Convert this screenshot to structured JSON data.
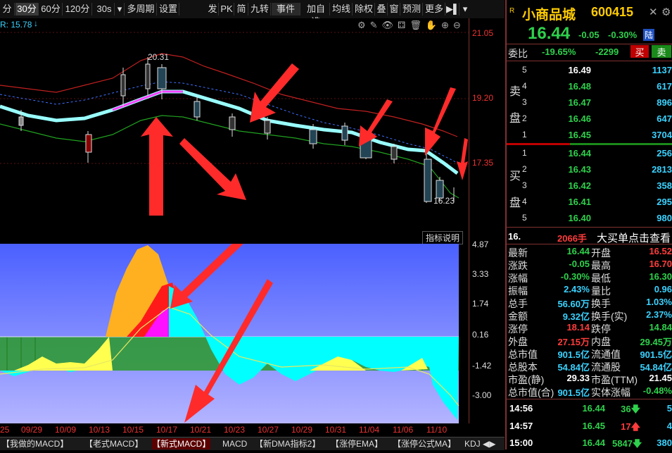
{
  "toolbar": {
    "items": [
      "分",
      "30分",
      "60分",
      "120分",
      "30s",
      "多周期",
      "设置"
    ],
    "right_items": [
      "发",
      "PK",
      "简",
      "九转",
      "事件",
      "加自选",
      "均线",
      "除权",
      "叠",
      "窗",
      "预测",
      "更多"
    ]
  },
  "chart": {
    "ma_label": "R: 15.78",
    "price_axis": [
      "21.05",
      "19.20",
      "17.35"
    ],
    "high_marker": "20.31",
    "low_marker": "16.23",
    "macd_header": "指标说明",
    "macd_axis": [
      "4.87",
      "3.33",
      "1.74",
      "0.16",
      "-1.42",
      "-3.00"
    ],
    "dates": [
      "25",
      "09/29",
      "10/09",
      "10/13",
      "10/15",
      "10/17",
      "10/21",
      "10/23",
      "10/27",
      "10/29",
      "10/31",
      "11/04",
      "11/06",
      "11/10"
    ]
  },
  "bottom_tabs": [
    "我做的MACD",
    "老式MACD",
    "新式MACD",
    "MACD",
    "新DMA指标2",
    "涨停EMA",
    "涨停公式MA",
    "KDJ"
  ],
  "quote": {
    "name": "小商品城",
    "code": "600415",
    "price": "16.44",
    "change": "-0.05",
    "change_pct": "-0.30%",
    "exchange": "陆",
    "weibi_label": "委比",
    "weibi": "-19.65%",
    "weicha": "-2299",
    "sell_btn": "买",
    "buy_btn": "卖",
    "sell_label": [
      "卖",
      "盘"
    ],
    "buy_label": [
      "买",
      "盘"
    ],
    "asks": [
      {
        "lvl": "5",
        "price": "16.49",
        "vol": "1137"
      },
      {
        "lvl": "4",
        "price": "16.48",
        "vol": "617"
      },
      {
        "lvl": "3",
        "price": "16.47",
        "vol": "896"
      },
      {
        "lvl": "2",
        "price": "16.46",
        "vol": "647"
      },
      {
        "lvl": "1",
        "price": "16.45",
        "vol": "3704"
      }
    ],
    "bids": [
      {
        "lvl": "1",
        "price": "16.44",
        "vol": "256"
      },
      {
        "lvl": "2",
        "price": "16.43",
        "vol": "2813"
      },
      {
        "lvl": "3",
        "price": "16.42",
        "vol": "358"
      },
      {
        "lvl": "4",
        "price": "16.41",
        "vol": "295"
      },
      {
        "lvl": "5",
        "price": "16.40",
        "vol": "980"
      }
    ],
    "big_order_price": "16.",
    "big_order_vol": "2066手",
    "big_order_link": "大买单点击查看",
    "stats": [
      {
        "l1": "最新",
        "v1": "16.44",
        "c1": "green",
        "l2": "开盘",
        "v2": "16.52",
        "c2": "red"
      },
      {
        "l1": "涨跌",
        "v1": "-0.05",
        "c1": "green",
        "l2": "最高",
        "v2": "16.70",
        "c2": "red"
      },
      {
        "l1": "涨幅",
        "v1": "-0.30%",
        "c1": "green",
        "l2": "最低",
        "v2": "16.30",
        "c2": "green"
      },
      {
        "l1": "振幅",
        "v1": "2.43%",
        "c1": "cyan",
        "l2": "量比",
        "v2": "0.96",
        "c2": "cyan"
      },
      {
        "l1": "总手",
        "v1": "56.60万",
        "c1": "cyan",
        "l2": "换手",
        "v2": "1.03%",
        "c2": "cyan"
      },
      {
        "l1": "金额",
        "v1": "9.32亿",
        "c1": "cyan",
        "l2": "换手(实)",
        "v2": "2.37%",
        "c2": "cyan"
      },
      {
        "l1": "涨停",
        "v1": "18.14",
        "c1": "red",
        "l2": "跌停",
        "v2": "14.84",
        "c2": "green"
      },
      {
        "l1": "外盘",
        "v1": "27.15万",
        "c1": "red",
        "l2": "内盘",
        "v2": "29.45万",
        "c2": "green"
      },
      {
        "l1": "总市值",
        "v1": "901.5亿",
        "c1": "cyan",
        "l2": "流通值",
        "v2": "901.5亿",
        "c2": "cyan"
      },
      {
        "l1": "总股本",
        "v1": "54.84亿",
        "c1": "cyan",
        "l2": "流通股",
        "v2": "54.84亿",
        "c2": "cyan"
      },
      {
        "l1": "市盈(静)",
        "v1": "29.33",
        "c1": "white",
        "l2": "市盈(TTM)",
        "v2": "21.45",
        "c2": "white"
      },
      {
        "l1": "总市值(合)",
        "v1": "901.5亿",
        "c1": "cyan",
        "l2": "实体涨幅",
        "v2": "-0.48%",
        "c2": "green"
      }
    ],
    "ticks": [
      {
        "time": "14:56",
        "price": "16.44",
        "vol": "36",
        "dir": "down",
        "cnt": "5"
      },
      {
        "time": "14:57",
        "price": "16.45",
        "vol": "17",
        "dir": "up",
        "cnt": "4"
      },
      {
        "time": "15:00",
        "price": "16.44",
        "vol": "5847",
        "dir": "down",
        "cnt": "380"
      }
    ]
  },
  "colors": {
    "up": "#ff3c3c",
    "down": "#2ed14c",
    "accent": "#3ad2ff",
    "arrow": "#ff3030"
  }
}
